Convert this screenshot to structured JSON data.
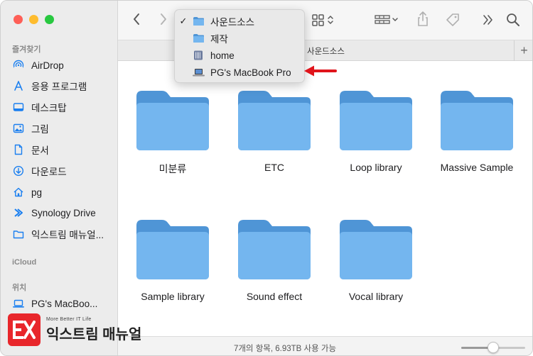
{
  "sidebar": {
    "favorites_header": "즐겨찾기",
    "items": [
      {
        "label": "AirDrop",
        "icon": "airdrop-icon"
      },
      {
        "label": "응용 프로그램",
        "icon": "applications-icon"
      },
      {
        "label": "데스크탑",
        "icon": "desktop-icon"
      },
      {
        "label": "그림",
        "icon": "pictures-icon"
      },
      {
        "label": "문서",
        "icon": "document-icon"
      },
      {
        "label": "다운로드",
        "icon": "download-icon"
      },
      {
        "label": "pg",
        "icon": "home-icon"
      },
      {
        "label": "Synology Drive",
        "icon": "synology-drive-icon"
      },
      {
        "label": "익스트림 매뉴얼...",
        "icon": "folder-icon"
      }
    ],
    "icloud_header": "iCloud",
    "locations_header": "위치",
    "locations": [
      {
        "label": "PG's MacBoo...",
        "icon": "laptop-icon"
      }
    ]
  },
  "toolbar": {
    "back_icon": "chevron-left-icon",
    "forward_icon": "chevron-right-icon",
    "view_icon": "grid-view-icon",
    "group_icon": "group-icon",
    "share_icon": "share-icon",
    "tag_icon": "tag-icon",
    "more_icon": "chevron-double-right-icon",
    "search_icon": "search-icon"
  },
  "tab": {
    "title": "사운드소스",
    "plus": "+"
  },
  "dropdown": {
    "items": [
      {
        "label": "사운드소스",
        "checked": "✓",
        "icon": "folder-icon"
      },
      {
        "label": "제작",
        "checked": "",
        "icon": "folder-icon"
      },
      {
        "label": "home",
        "checked": "",
        "icon": "server-icon"
      },
      {
        "label": "PG's MacBook Pro",
        "checked": "",
        "icon": "laptop-icon"
      }
    ]
  },
  "folders": [
    {
      "name": "미분류"
    },
    {
      "name": "ETC"
    },
    {
      "name": "Loop library"
    },
    {
      "name": "Massive Sample"
    },
    {
      "name": "Sample library"
    },
    {
      "name": "Sound effect"
    },
    {
      "name": "Vocal library"
    }
  ],
  "status": {
    "text": "7개의 항목, 6.93TB 사용 가능",
    "zoom_level": 0.5
  },
  "watermark": {
    "logo_glyph": "EX",
    "sub": "More Better IT Life",
    "main": "익스트림 매뉴얼"
  },
  "colors": {
    "accent": "#1a7ff0",
    "folder_front": "#74b6ef",
    "folder_back": "#4f95d6",
    "arrow": "#e0141b",
    "watermark": "#e8262b"
  }
}
